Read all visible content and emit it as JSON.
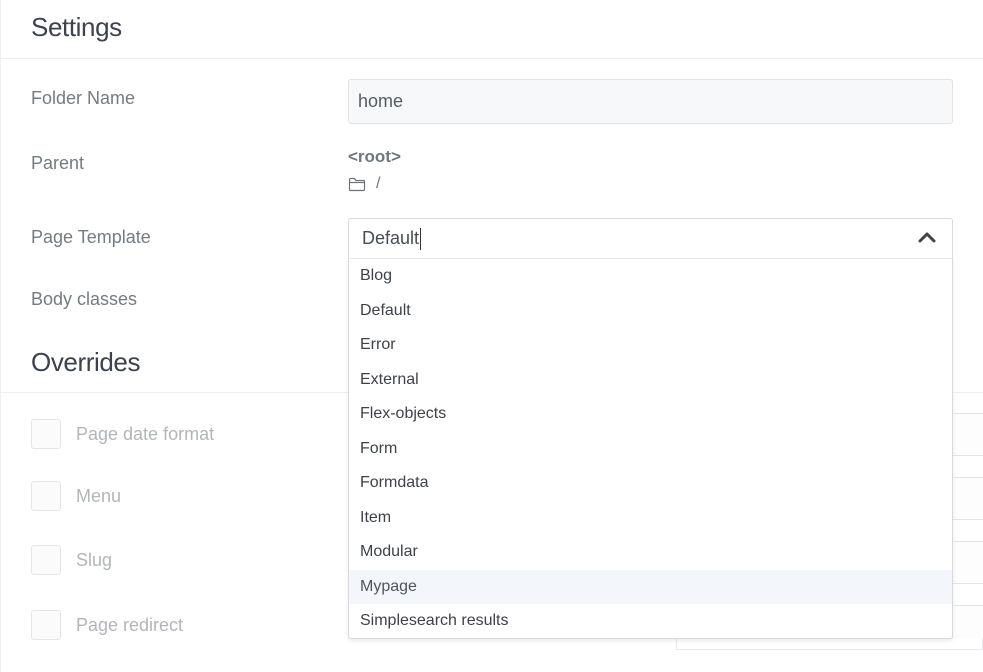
{
  "settings": {
    "title": "Settings",
    "folder_name": {
      "label": "Folder Name",
      "value": "home"
    },
    "parent": {
      "label": "Parent",
      "root": "<root>",
      "path": "/",
      "icon": "folder-icon"
    },
    "page_template": {
      "label": "Page Template",
      "value": "Default",
      "options": [
        "Blog",
        "Default",
        "Error",
        "External",
        "Flex-objects",
        "Form",
        "Formdata",
        "Item",
        "Modular",
        "Mypage",
        "Simplesearch results"
      ],
      "highlighted": "Mypage"
    },
    "body_classes": {
      "label": "Body classes"
    }
  },
  "overrides": {
    "title": "Overrides",
    "items": [
      {
        "label": "Page date format",
        "checked": false
      },
      {
        "label": "Menu",
        "checked": false
      },
      {
        "label": "Slug",
        "checked": false
      },
      {
        "label": "Page redirect",
        "checked": false
      }
    ]
  },
  "colors": {
    "highlight_bg": "#f3f7fb",
    "heading": "#3d424e",
    "label": "#737c81",
    "muted": "#b1b6bb"
  }
}
